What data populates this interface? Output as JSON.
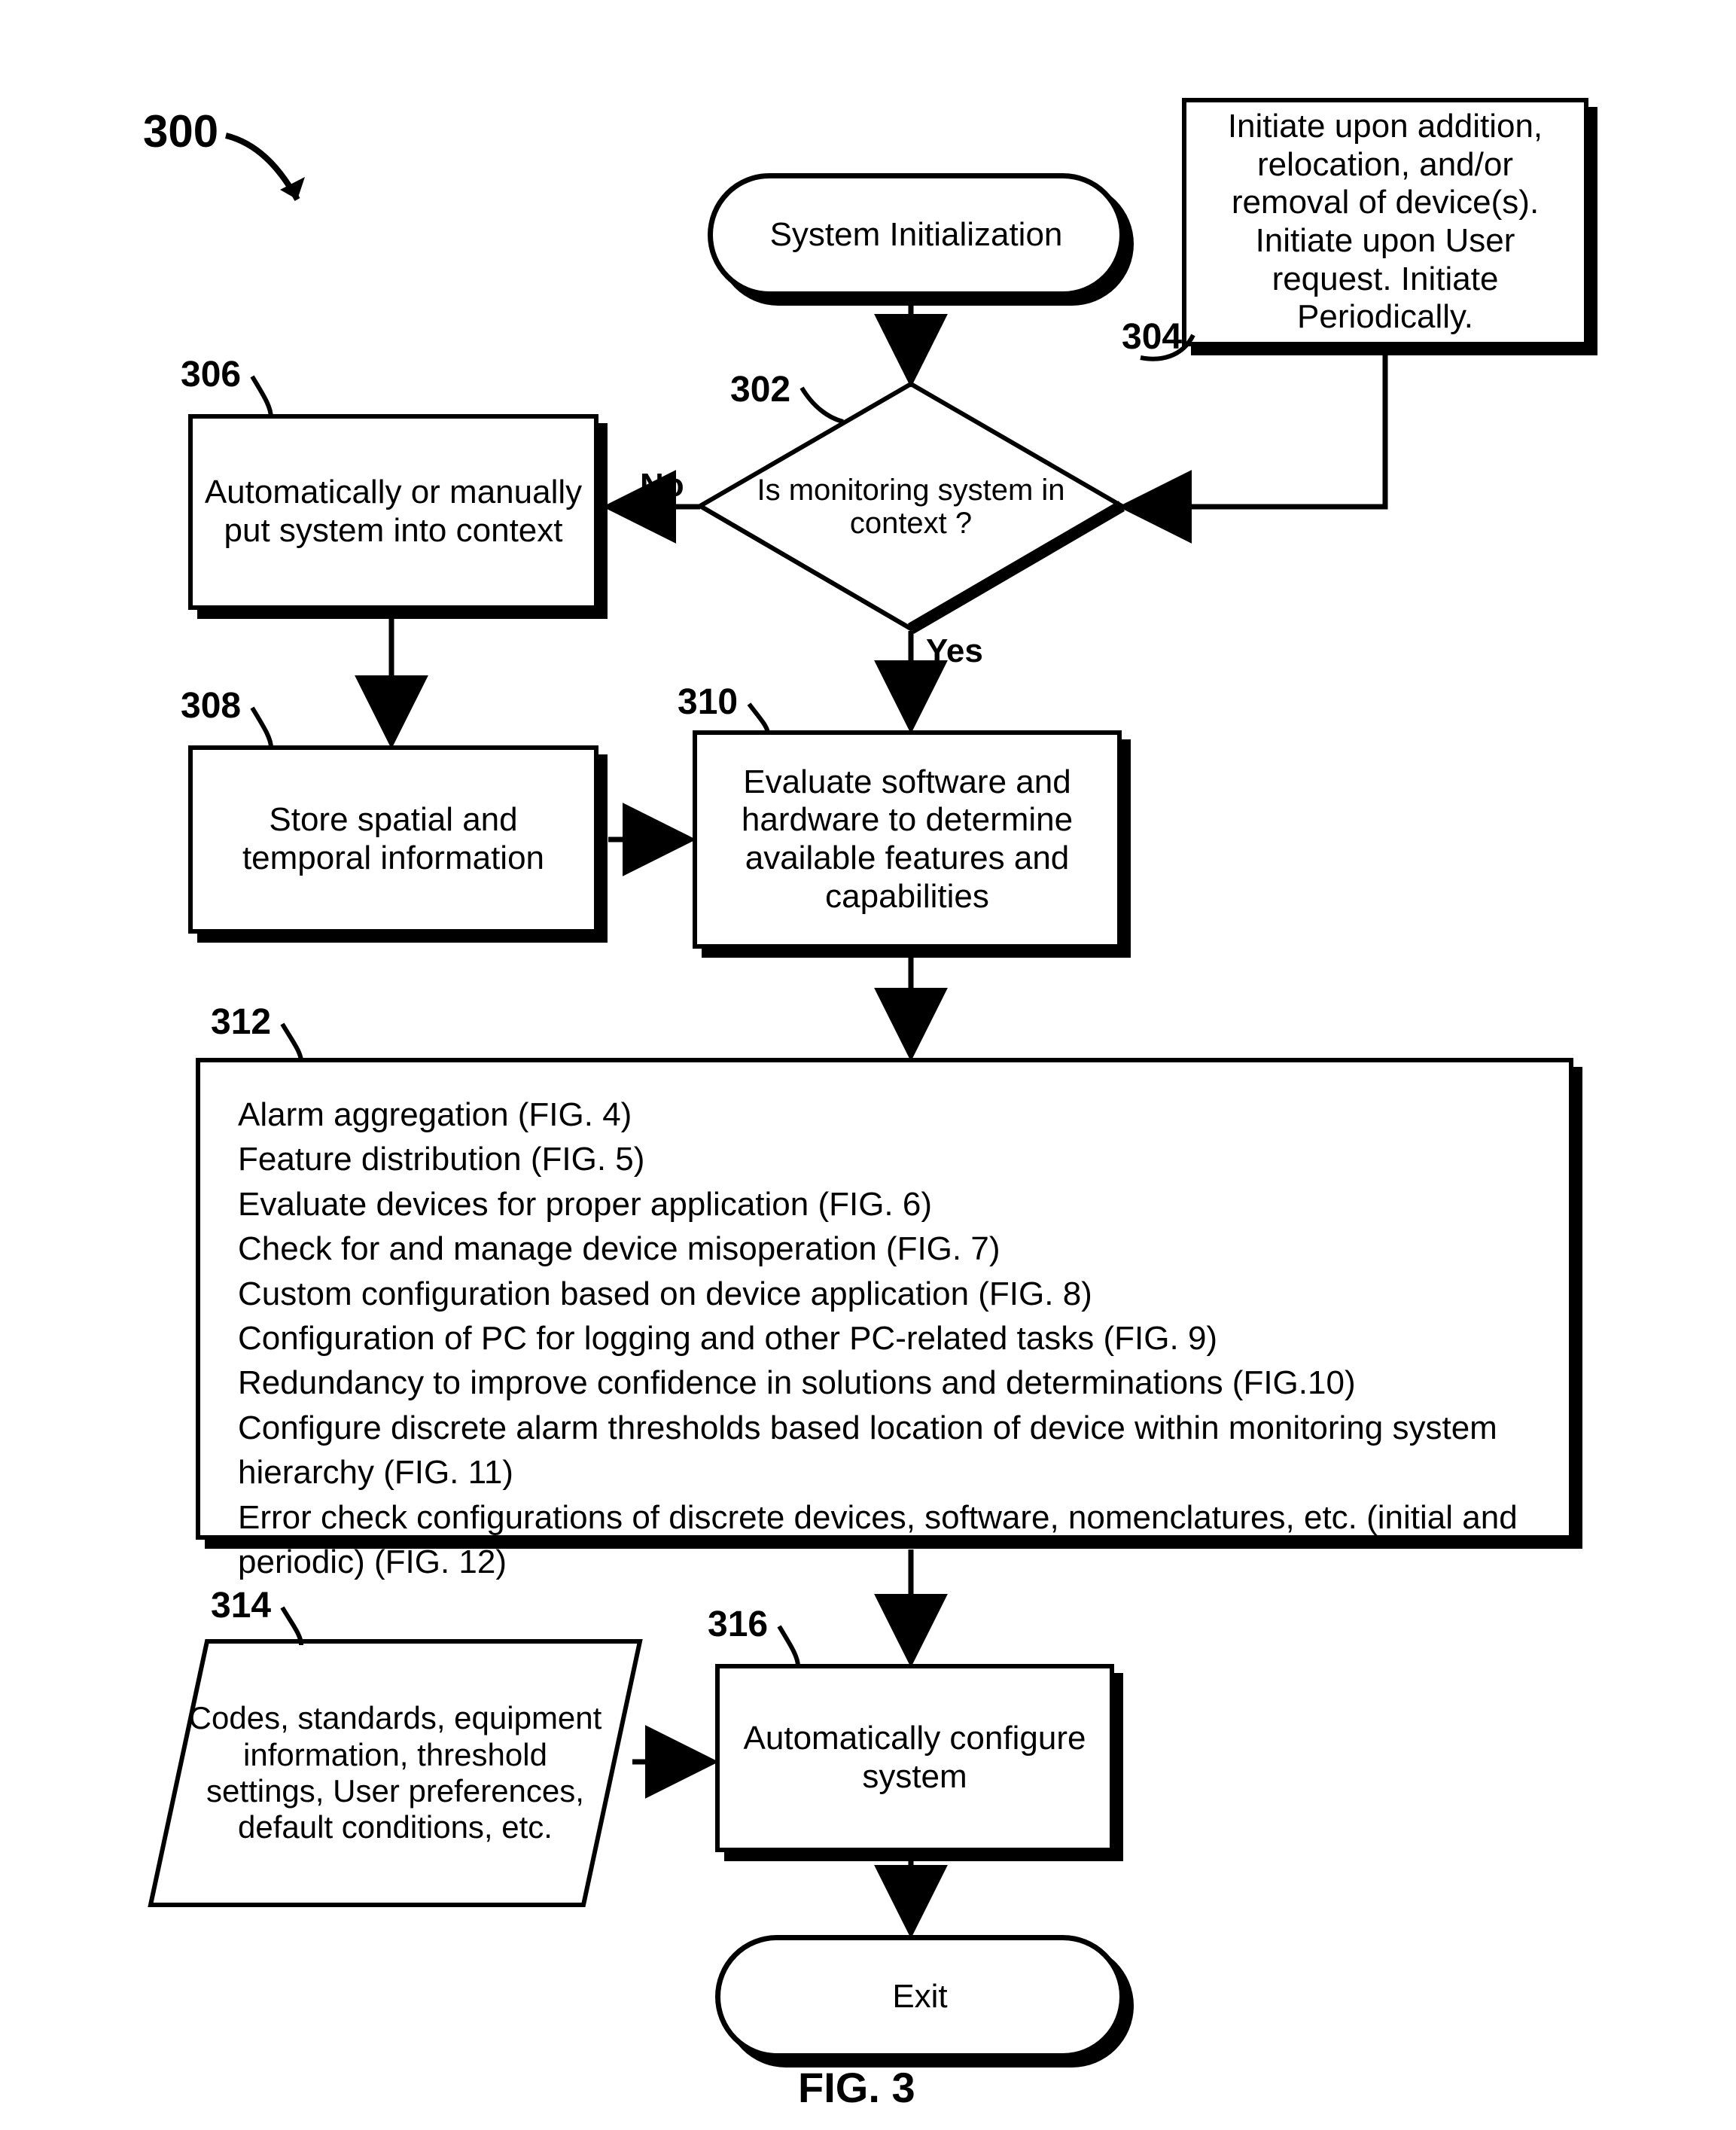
{
  "chart_data": {
    "type": "flowchart",
    "title": "FIG. 3",
    "diagram_ref": "300",
    "nodes": [
      {
        "id": "start",
        "ref": null,
        "type": "terminator",
        "text": "System Initialization"
      },
      {
        "id": "n304",
        "ref": "304",
        "type": "process",
        "text": "Initiate upon addition, relocation, and/or removal of device(s). Initiate upon User request. Initiate Periodically."
      },
      {
        "id": "n302",
        "ref": "302",
        "type": "decision",
        "text": "Is monitoring system in context ?"
      },
      {
        "id": "n306",
        "ref": "306",
        "type": "process",
        "text": "Automatically or manually put system into context"
      },
      {
        "id": "n308",
        "ref": "308",
        "type": "process",
        "text": "Store spatial and temporal information"
      },
      {
        "id": "n310",
        "ref": "310",
        "type": "process",
        "text": "Evaluate software and hardware to determine available features and capabilities"
      },
      {
        "id": "n312",
        "ref": "312",
        "type": "process",
        "text_lines": [
          "Alarm aggregation (FIG. 4)",
          "Feature distribution (FIG. 5)",
          "Evaluate devices for proper application (FIG. 6)",
          "Check for and manage device misoperation (FIG. 7)",
          "Custom configuration based on device application (FIG. 8)",
          "Configuration of PC for logging and other PC-related tasks (FIG. 9)",
          "Redundancy to improve confidence in solutions and determinations (FIG.10)",
          "Configure discrete alarm thresholds based location of device within monitoring system hierarchy (FIG. 11)",
          "Error check configurations of discrete devices, software, nomenclatures, etc. (initial and periodic) (FIG. 12)"
        ]
      },
      {
        "id": "n314",
        "ref": "314",
        "type": "data",
        "text": "Codes, standards, equipment information, threshold settings, User preferences, default conditions, etc."
      },
      {
        "id": "n316",
        "ref": "316",
        "type": "process",
        "text": "Automatically configure system"
      },
      {
        "id": "exit",
        "ref": null,
        "type": "terminator",
        "text": "Exit"
      }
    ],
    "edges": [
      {
        "from": "start",
        "to": "n302",
        "label": null
      },
      {
        "from": "n304",
        "to": "n302",
        "label": null
      },
      {
        "from": "n302",
        "to": "n306",
        "label": "No"
      },
      {
        "from": "n302",
        "to": "n310",
        "label": "Yes"
      },
      {
        "from": "n306",
        "to": "n308",
        "label": null
      },
      {
        "from": "n308",
        "to": "n310",
        "label": null
      },
      {
        "from": "n310",
        "to": "n312",
        "label": null
      },
      {
        "from": "n312",
        "to": "n316",
        "label": null
      },
      {
        "from": "n314",
        "to": "n316",
        "label": null
      },
      {
        "from": "n316",
        "to": "exit",
        "label": null
      }
    ]
  },
  "labels": {
    "fig": "FIG. 3",
    "ref300": "300",
    "ref302": "302",
    "ref304": "304",
    "ref306": "306",
    "ref308": "308",
    "ref310": "310",
    "ref312": "312",
    "ref314": "314",
    "ref316": "316",
    "no": "No",
    "yes": "Yes"
  },
  "nodes": {
    "start": "System Initialization",
    "n304": "Initiate upon addition, relocation, and/or removal of device(s). Initiate upon User request. Initiate Periodically.",
    "n302": "Is monitoring system in context ?",
    "n306": "Automatically or manually put system into context",
    "n308": "Store spatial and temporal information",
    "n310": "Evaluate software and hardware to determine available features and capabilities",
    "n312_l0": "Alarm aggregation (FIG. 4)",
    "n312_l1": "Feature distribution (FIG. 5)",
    "n312_l2": "Evaluate devices for proper application (FIG. 6)",
    "n312_l3": "Check for and manage device misoperation (FIG. 7)",
    "n312_l4": "Custom configuration based on device application (FIG. 8)",
    "n312_l5": "Configuration of PC for logging and other PC-related tasks (FIG. 9)",
    "n312_l6": "Redundancy to improve confidence in solutions and determinations (FIG.10)",
    "n312_l7": "Configure discrete alarm thresholds based location of device within monitoring system hierarchy (FIG. 11)",
    "n312_l8": "Error check configurations of discrete devices, software, nomenclatures, etc. (initial and periodic) (FIG. 12)",
    "n314": "Codes, standards, equipment information, threshold settings, User preferences, default conditions, etc.",
    "n316": "Automatically configure system",
    "exit": "Exit"
  }
}
